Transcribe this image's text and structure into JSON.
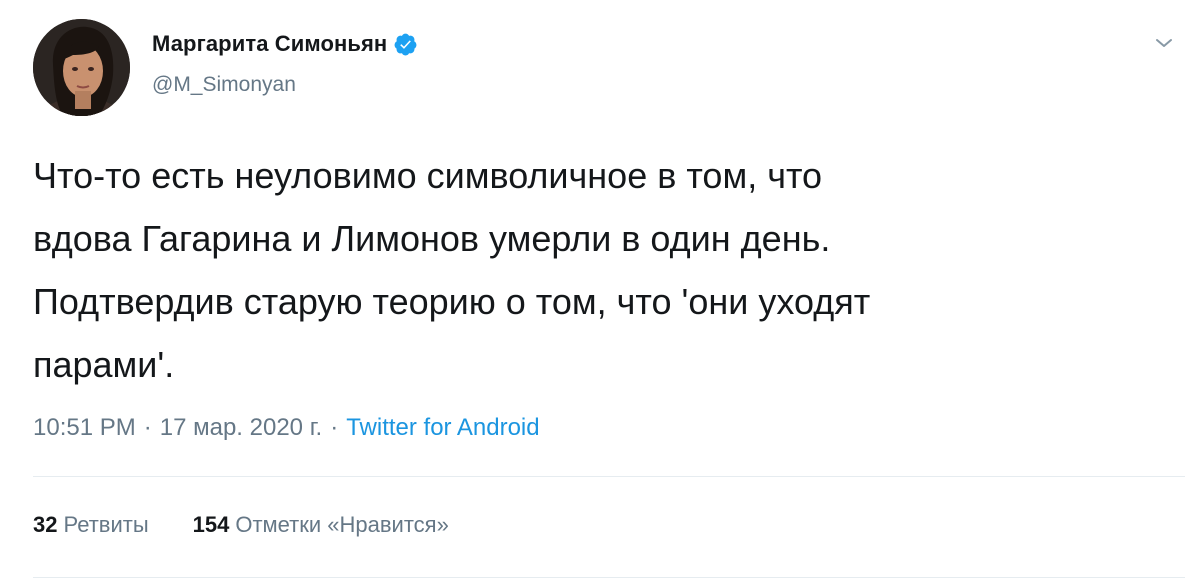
{
  "author": {
    "display_name": "Маргарита Симоньян",
    "handle": "@M_Simonyan",
    "verified_color": "#1da1f2"
  },
  "tweet": {
    "lines": [
      "Что-то есть неуловимо символичное в том, что",
      "вдова Гагарина и Лимонов умерли в один день.",
      "Подтвердив старую теорию о том, что 'они уходят",
      "парами'."
    ]
  },
  "meta": {
    "time": "10:51 PM",
    "separator": "·",
    "date": "17 мар. 2020 г.",
    "source": "Twitter for Android"
  },
  "stats": {
    "retweets_count": "32",
    "retweets_label": "Ретвиты",
    "likes_count": "154",
    "likes_label": "Отметки «Нравится»"
  },
  "icons": {
    "verified": "verified-badge-icon",
    "caret": "chevron-down-icon"
  },
  "colors": {
    "link": "#1b95e0",
    "secondary_text": "#657786",
    "primary_text": "#14171a"
  }
}
